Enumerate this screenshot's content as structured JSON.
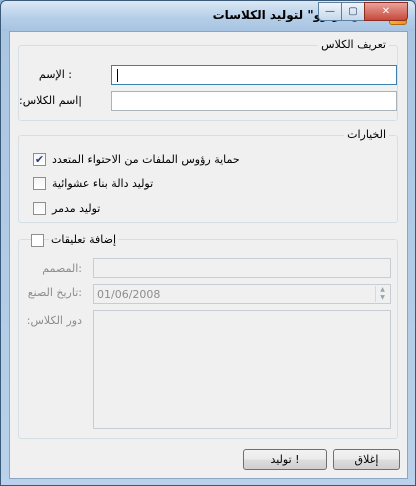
{
  "window": {
    "title": "كلاس \"زيرو\" لتوليد الكلاسات",
    "caption_buttons": {
      "minimize": "—",
      "maximize": "▢",
      "close": "✕"
    }
  },
  "class_definition": {
    "legend": "تعريف الكلاس",
    "name_label": ": الإسم",
    "name_value": "",
    "class_name_label": "|اسم الكلاس:",
    "class_name_value": ""
  },
  "options": {
    "legend": "الخيارات",
    "items": [
      {
        "label": "حماية رؤوس الملفات من الاحتواء المتعدد",
        "checked": true
      },
      {
        "label": "توليد دالة بناء عشوائية",
        "checked": false
      },
      {
        "label": "توليد مدمر",
        "checked": false
      }
    ]
  },
  "comments": {
    "legend": "إضافة تعليقات",
    "checked": false,
    "designer_label": ":المصمم",
    "designer_value": "",
    "date_label": ":تاريخ الصنع",
    "date_value": "01/06/2008",
    "role_label": "دور الكلاس:",
    "role_value": ""
  },
  "buttons": {
    "generate": "! توليد",
    "close": "إغلاق"
  },
  "icons": {
    "app": "app-icon",
    "check": "✔"
  }
}
